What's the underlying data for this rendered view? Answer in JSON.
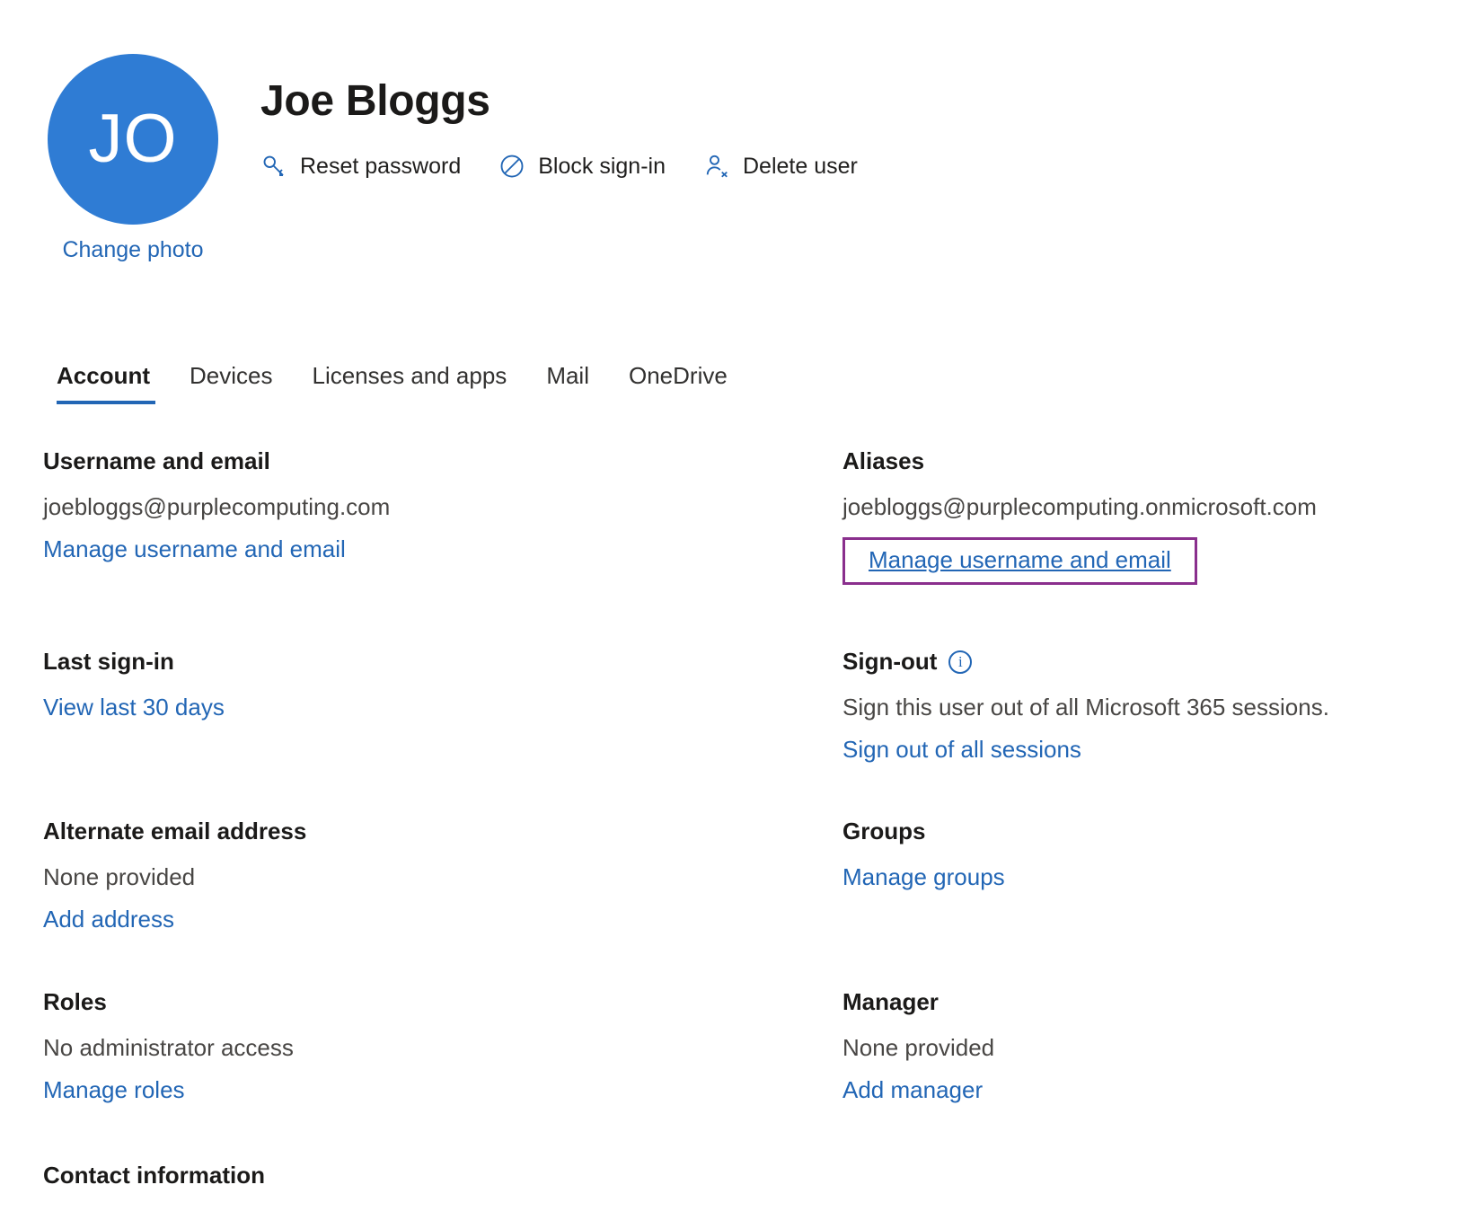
{
  "user": {
    "initials": "JO",
    "display_name": "Joe Bloggs",
    "change_photo_label": "Change photo",
    "avatar_color": "#2f7cd4"
  },
  "actions": [
    {
      "id": "reset-password",
      "label": "Reset password",
      "icon": "key-icon"
    },
    {
      "id": "block-sign-in",
      "label": "Block sign-in",
      "icon": "block-icon"
    },
    {
      "id": "delete-user",
      "label": "Delete user",
      "icon": "person-delete-icon"
    }
  ],
  "tabs": [
    {
      "id": "account",
      "label": "Account",
      "active": true
    },
    {
      "id": "devices",
      "label": "Devices",
      "active": false
    },
    {
      "id": "licenses-and-apps",
      "label": "Licenses and apps",
      "active": false
    },
    {
      "id": "mail",
      "label": "Mail",
      "active": false
    },
    {
      "id": "onedrive",
      "label": "OneDrive",
      "active": false
    }
  ],
  "account": {
    "username_and_email": {
      "title": "Username and email",
      "value": "joebloggs@purplecomputing.com",
      "link": "Manage username and email"
    },
    "aliases": {
      "title": "Aliases",
      "value": "joebloggs@purplecomputing.onmicrosoft.com",
      "link": "Manage username and email",
      "highlight_color": "#8a2f8d"
    },
    "last_sign_in": {
      "title": "Last sign-in",
      "link": "View last 30 days"
    },
    "sign_out": {
      "title": "Sign-out",
      "info_icon": "info-icon",
      "value": "Sign this user out of all Microsoft 365 sessions.",
      "link": "Sign out of all sessions"
    },
    "alternate_email": {
      "title": "Alternate email address",
      "value": "None provided",
      "link": "Add address"
    },
    "groups": {
      "title": "Groups",
      "link": "Manage groups"
    },
    "roles": {
      "title": "Roles",
      "value": "No administrator access",
      "link": "Manage roles"
    },
    "manager": {
      "title": "Manager",
      "value": "None provided",
      "link": "Add manager"
    },
    "contact_information_title": "Contact information"
  },
  "colors": {
    "link": "#2266b5",
    "text": "#323130",
    "heading": "#1b1a19",
    "highlight": "#8a2f8d"
  }
}
